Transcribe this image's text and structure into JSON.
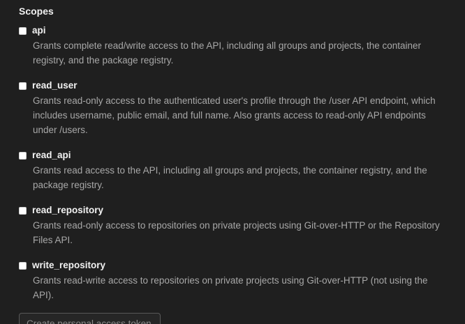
{
  "section": {
    "title": "Scopes"
  },
  "scopes": [
    {
      "label": "api",
      "description": "Grants complete read/write access to the API, including all groups and projects, the container registry, and the package registry."
    },
    {
      "label": "read_user",
      "description": "Grants read-only access to the authenticated user's profile through the /user API endpoint, which includes username, public email, and full name. Also grants access to read-only API endpoints under /users."
    },
    {
      "label": "read_api",
      "description": "Grants read access to the API, including all groups and projects, the container registry, and the package registry."
    },
    {
      "label": "read_repository",
      "description": "Grants read-only access to repositories on private projects using Git-over-HTTP or the Repository Files API."
    },
    {
      "label": "write_repository",
      "description": "Grants read-write access to repositories on private projects using Git-over-HTTP (not using the API)."
    }
  ],
  "actions": {
    "submit_label": "Create personal access token"
  }
}
